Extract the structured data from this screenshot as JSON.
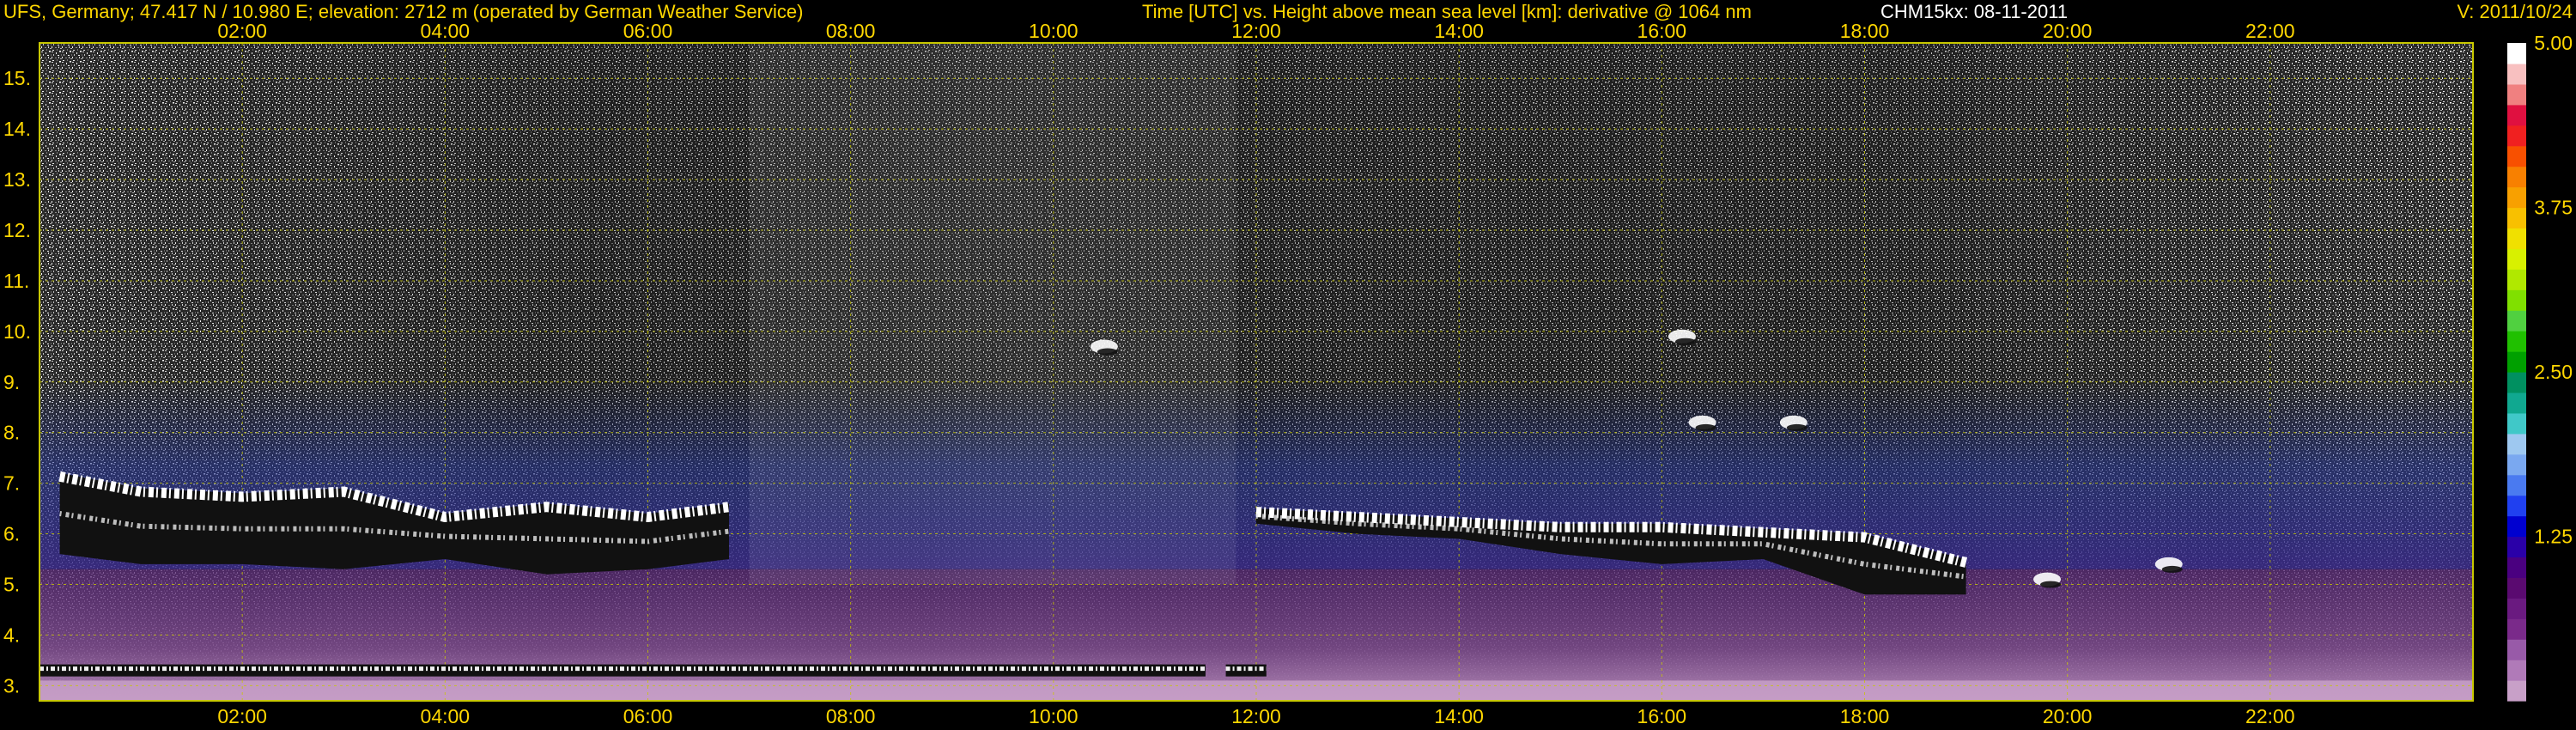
{
  "header": {
    "station": "UFS, Germany; 47.417 N / 10.980 E; elevation: 2712 m  (operated by German Weather Service)",
    "description": "Time [UTC] vs. Height above mean sea level [km]: derivative @ 1064 nm",
    "instrument": "CHM15kx: 08-11-2011",
    "version": "V: 2011/10/24"
  },
  "colors": {
    "background": "#000000",
    "text": "#ffd700",
    "grid": "#c8c800",
    "cloud": "#ffffff",
    "boundary_layer": "#6a3a78"
  },
  "chart_data": {
    "type": "heatmap",
    "title": "Time [UTC] vs. Height above mean sea level [km]: derivative @ 1064 nm",
    "xlabel": "Time [UTC]",
    "ylabel": "Height above mean sea level [km]",
    "x_unit": "hours UTC",
    "xlim": [
      0,
      24
    ],
    "ylim": [
      2.7,
      15.7
    ],
    "x_ticks": [
      2,
      4,
      6,
      8,
      10,
      12,
      14,
      16,
      18,
      20,
      22
    ],
    "x_tick_labels": [
      "02:00",
      "04:00",
      "06:00",
      "08:00",
      "10:00",
      "12:00",
      "14:00",
      "16:00",
      "18:00",
      "20:00",
      "22:00"
    ],
    "y_ticks": [
      3,
      4,
      5,
      6,
      7,
      8,
      9,
      10,
      11,
      12,
      13,
      14,
      15
    ],
    "y_tick_labels": [
      "3.",
      "4.",
      "5.",
      "6.",
      "7.",
      "8.",
      "9.",
      "10.",
      "11.",
      "12.",
      "13.",
      "14.",
      "15."
    ],
    "grid": true,
    "colorbar": {
      "ticks": [
        1.25,
        2.5,
        3.75,
        5.0
      ],
      "tick_labels": [
        "1.25",
        "2.50",
        "3.75",
        "5.00"
      ],
      "range": [
        0,
        5
      ],
      "colors": [
        "#c8a0c8",
        "#b07ab8",
        "#985aa8",
        "#7a2a8a",
        "#6a1a80",
        "#5a0a70",
        "#4a0080",
        "#2a00a8",
        "#0000d0",
        "#2040f0",
        "#4a7af0",
        "#7aa8f0",
        "#9ec8f0",
        "#40c8c8",
        "#10a890",
        "#009060",
        "#00a000",
        "#20c000",
        "#50d040",
        "#80e000",
        "#b0e800",
        "#d8f000",
        "#f0e000",
        "#f8c000",
        "#f8a000",
        "#f88000",
        "#f85000",
        "#f02020",
        "#e01040",
        "#f08080",
        "#f8c0c0",
        "#ffffff"
      ]
    },
    "cloud_layer_tops": [
      {
        "time": 0.2,
        "base_km": 5.6,
        "top_km": 7.2
      },
      {
        "time": 1.0,
        "base_km": 5.4,
        "top_km": 6.9
      },
      {
        "time": 2.0,
        "base_km": 5.4,
        "top_km": 6.8
      },
      {
        "time": 3.0,
        "base_km": 5.3,
        "top_km": 6.9
      },
      {
        "time": 4.0,
        "base_km": 5.5,
        "top_km": 6.4
      },
      {
        "time": 5.0,
        "base_km": 5.2,
        "top_km": 6.6
      },
      {
        "time": 6.0,
        "base_km": 5.3,
        "top_km": 6.4
      },
      {
        "time": 6.8,
        "base_km": 5.5,
        "top_km": 6.6
      },
      {
        "time": 12.0,
        "base_km": 6.2,
        "top_km": 6.5
      },
      {
        "time": 13.0,
        "base_km": 6.0,
        "top_km": 6.4
      },
      {
        "time": 14.0,
        "base_km": 5.9,
        "top_km": 6.3
      },
      {
        "time": 15.0,
        "base_km": 5.6,
        "top_km": 6.2
      },
      {
        "time": 16.0,
        "base_km": 5.4,
        "top_km": 6.2
      },
      {
        "time": 17.0,
        "base_km": 5.5,
        "top_km": 6.1
      },
      {
        "time": 18.0,
        "base_km": 4.8,
        "top_km": 6.0
      },
      {
        "time": 19.0,
        "base_km": 4.8,
        "top_km": 5.5
      }
    ],
    "isolated_clouds": [
      {
        "time": 10.5,
        "height_km": 9.7
      },
      {
        "time": 16.2,
        "height_km": 9.9
      },
      {
        "time": 16.4,
        "height_km": 8.2
      },
      {
        "time": 17.3,
        "height_km": 8.2
      },
      {
        "time": 19.8,
        "height_km": 5.1
      },
      {
        "time": 21.0,
        "height_km": 5.4
      }
    ],
    "surface_layer": [
      {
        "time_start": 0.0,
        "time_end": 11.5,
        "height_km": 3.3
      },
      {
        "time_start": 11.7,
        "time_end": 12.1,
        "height_km": 3.3
      }
    ]
  }
}
